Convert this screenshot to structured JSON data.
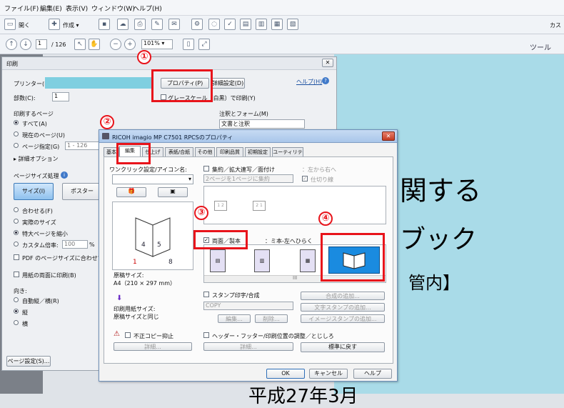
{
  "menubar": {
    "items": [
      "ファイル(F)",
      "編集(E)",
      "表示(V)",
      "ウィンドウ(W)",
      "ヘルプ(H)"
    ]
  },
  "toolbar1": {
    "open_label": "開く",
    "create_label": "作成 ▾",
    "right_label": "カス"
  },
  "toolbar2": {
    "page_current": "1",
    "page_total": "/ 126",
    "zoom": "101%",
    "tools_label": "ツール"
  },
  "document": {
    "line1": "関する",
    "line2": "ブック",
    "line3": "）管内】",
    "line4": "平成27年3月"
  },
  "print_dialog": {
    "title": "印刷",
    "printer_label": "プリンター(N)",
    "properties_btn": "プロパティ(P)",
    "advanced_btn": "詳細設定(D)",
    "help_link": "ヘルプ(H)",
    "copies_label": "部数(C):",
    "copies_value": "1",
    "grayscale_label": "グレースケール（白黒）で印刷(Y)",
    "pages_group": "印刷するページ",
    "opt_all": "すべて(A)",
    "opt_current": "現在のページ(U)",
    "opt_range": "ページ指定(G)",
    "range_value": "1 - 126",
    "more_options": "▸ 詳細オプション",
    "comments_label": "注釈とフォーム(M)",
    "comments_value": "文書と注釈",
    "size_group": "ページサイズ処理",
    "size_btn": "サイズ(I)",
    "poster_btn": "ポスター",
    "opt_fit": "合わせる(F)",
    "opt_actual": "実際のサイズ",
    "opt_shrink": "特大ページを縮小",
    "opt_custom": "カスタム倍率:",
    "custom_value": "100",
    "percent": "%",
    "pdf_size_chk": "PDF のページサイズに合わせて",
    "duplex_chk": "用紙の両面に印刷(B)",
    "orientation_label": "向き:",
    "opt_auto": "自動縦／横(R)",
    "opt_portrait": "縦",
    "opt_landscape": "横",
    "page_setup_btn": "ページ設定(S)..."
  },
  "props_dialog": {
    "title": "RICOH imagio MP C7501 RPCSのプロパティ",
    "tabs": [
      "基本",
      "編集",
      "仕上げ",
      "表紙/合紙",
      "その他",
      "印刷品質",
      "初期設定",
      "ユーティリティー"
    ],
    "oneclick_label": "ワンクリック設定/アイコン名:",
    "paper_size_label": "原稿サイズ:",
    "paper_size_value": "A4（210 × 297 mm）",
    "print_paper_label": "印刷用紙サイズ:",
    "print_paper_value": "原稿サイズと同じ",
    "combine_chk": "集約／拡大連写／面付け",
    "combine_select": "2ページを1ページに集約",
    "direction_label": "：左から右へ",
    "border_chk": "仕切り線",
    "duplex_chk": "両面／製本",
    "duplex_dir": "：ミ本-左へひらく",
    "stamp_chk": "スタンプ印字/合成",
    "stamp_value": "COPY",
    "add_combine_btn": "合成の追加...",
    "text_stamp_btn": "文字スタンプの追加...",
    "image_stamp_btn": "イメージスタンプの追加...",
    "edit_btn": "編集...",
    "delete_btn": "削除...",
    "anti_copy_chk": "不正コピー抑止",
    "detail_btn": "詳細...",
    "header_chk": "ヘッダー・フッター/印刷位置の調整／とじしろ",
    "detail_btn2": "詳細...",
    "default_btn": "標準に戻す",
    "ok_btn": "OK",
    "cancel_btn": "キャンセル",
    "help_btn": "ヘルプ",
    "scroll_mark": "III"
  },
  "annotations": {
    "n1": "①",
    "n2": "②",
    "n3": "③",
    "n4": "④"
  },
  "colors": {
    "accent_red": "#e8141b",
    "doc_bg": "#a9dbe8",
    "title_blue": "#a9c6ea"
  }
}
